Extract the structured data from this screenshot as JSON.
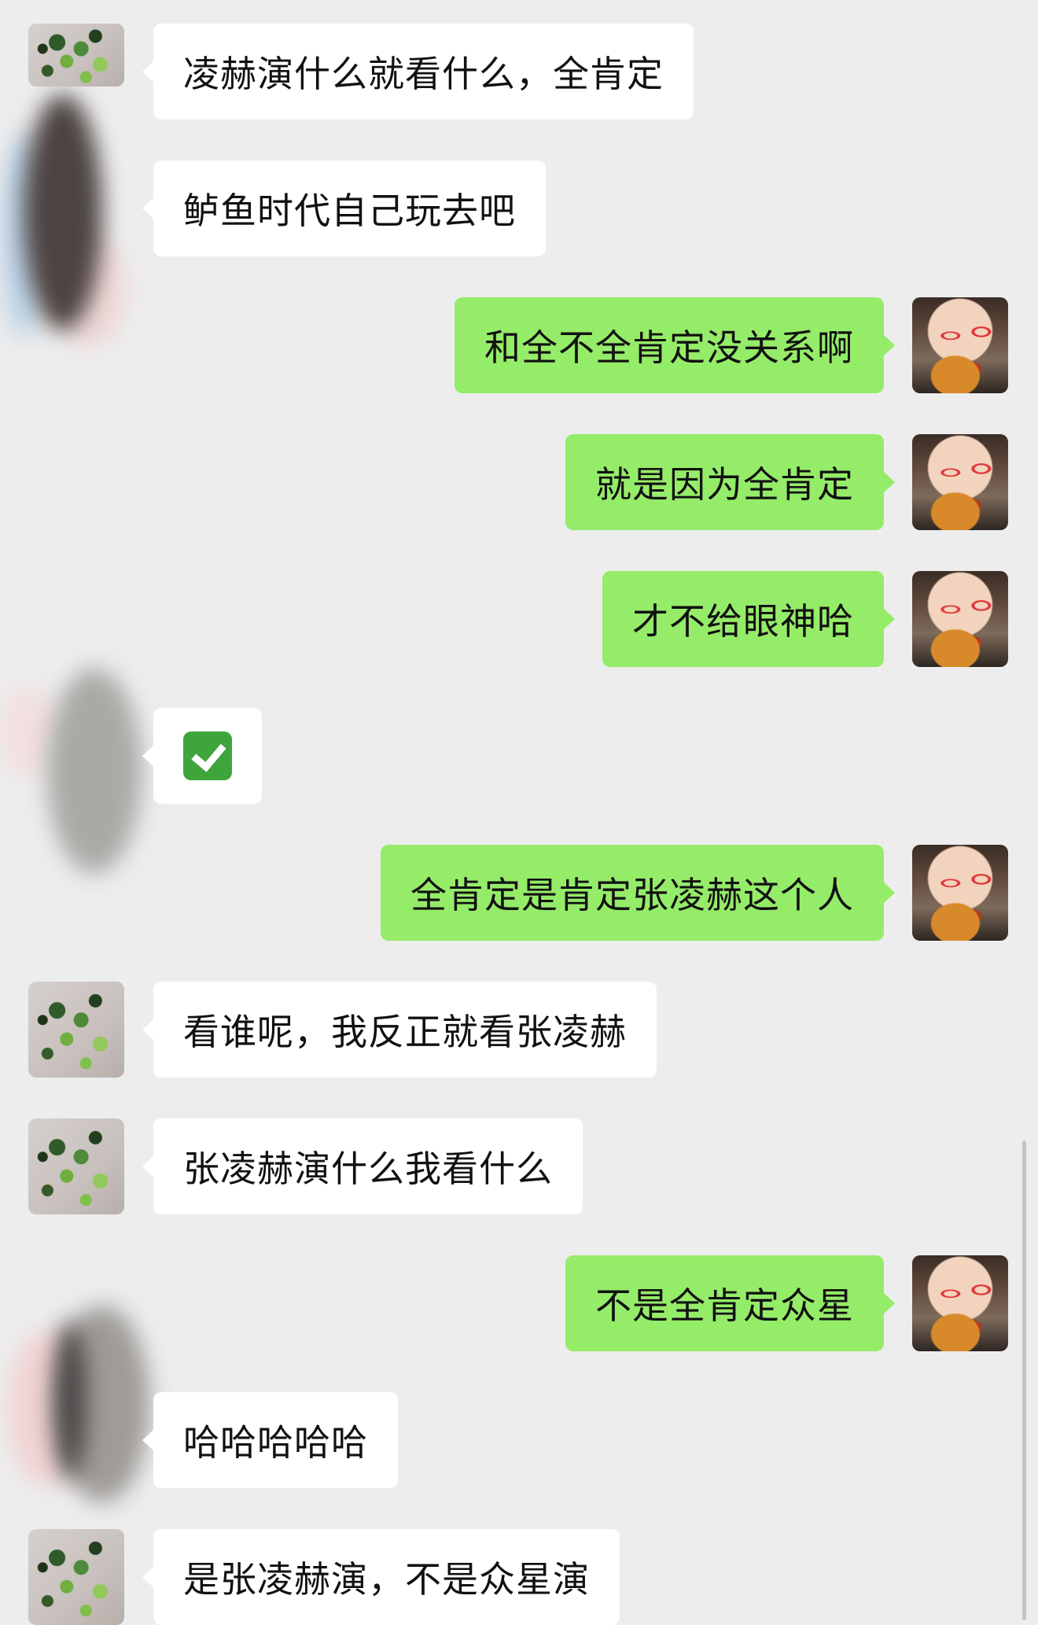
{
  "chat": {
    "messages": [
      {
        "sender": "contact",
        "text": "凌赫演什么就看什么，全肯定"
      },
      {
        "sender": "contact",
        "text": "鲈鱼时代自己玩去吧"
      },
      {
        "sender": "self",
        "text": "和全不全肯定没关系啊"
      },
      {
        "sender": "self",
        "text": "就是因为全肯定"
      },
      {
        "sender": "self",
        "text": "才不给眼神哈"
      },
      {
        "sender": "contact",
        "text": "✅",
        "emoji": "check-mark-emoji"
      },
      {
        "sender": "self",
        "text": "全肯定是肯定张凌赫这个人"
      },
      {
        "sender": "contact",
        "text": "看谁呢，我反正就看张凌赫"
      },
      {
        "sender": "contact",
        "text": "张凌赫演什么我看什么"
      },
      {
        "sender": "self",
        "text": "不是全肯定众星"
      },
      {
        "sender": "contact",
        "text": "哈哈哈哈哈"
      },
      {
        "sender": "contact",
        "text": "是张凌赫演，不是众星演"
      }
    ]
  },
  "colors": {
    "background": "#ededed",
    "outgoing_bubble": "#95ec69",
    "incoming_bubble": "#ffffff"
  },
  "icons": {
    "contact_avatar": "plant-avatar",
    "self_avatar": "person-avatar",
    "check": "check-mark-emoji"
  }
}
